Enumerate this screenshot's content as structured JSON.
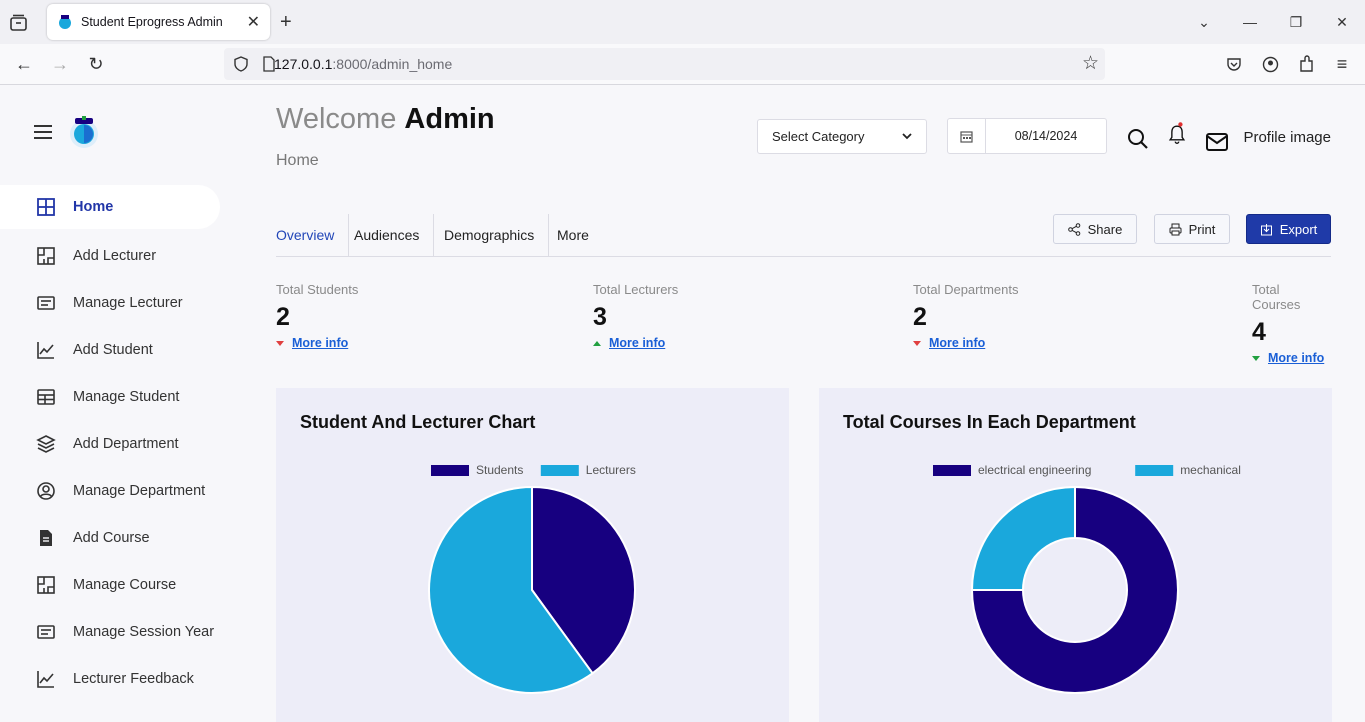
{
  "browser": {
    "tab_title": "Student Eprogress Admin",
    "url_host": "127.0.0.1",
    "url_rest": ":8000/admin_home"
  },
  "sidebar": {
    "items": [
      {
        "label": "Home",
        "icon": "grid-icon"
      },
      {
        "label": "Add Lecturer",
        "icon": "floorplan-icon"
      },
      {
        "label": "Manage Lecturer",
        "icon": "card-text-icon"
      },
      {
        "label": "Add Student",
        "icon": "graph-up-icon"
      },
      {
        "label": "Manage Student",
        "icon": "table-icon"
      },
      {
        "label": "Add Department",
        "icon": "layers-icon"
      },
      {
        "label": "Manage Department",
        "icon": "person-circle-icon"
      },
      {
        "label": "Add Course",
        "icon": "file-text-icon"
      },
      {
        "label": "Manage Course",
        "icon": "floorplan-icon"
      },
      {
        "label": "Manage Session Year",
        "icon": "card-text-icon"
      },
      {
        "label": "Lecturer Feedback",
        "icon": "graph-up-icon"
      }
    ]
  },
  "header": {
    "welcome": "Welcome",
    "user": "Admin",
    "breadcrumb": "Home",
    "select_label": "Select Category",
    "date": "08/14/2024",
    "profile": "Profile image"
  },
  "tabs": [
    "Overview",
    "Audiences",
    "Demographics",
    "More"
  ],
  "actions": {
    "share": "Share",
    "print": "Print",
    "export": "Export"
  },
  "stats": [
    {
      "label": "Total Students",
      "value": "2",
      "link": "More info",
      "trend": "down"
    },
    {
      "label": "Total Lecturers",
      "value": "3",
      "link": "More info",
      "trend": "up"
    },
    {
      "label": "Total Departments",
      "value": "2",
      "link": "More info",
      "trend": "down"
    },
    {
      "label": "Total Courses",
      "value": "4",
      "link": "More info",
      "trend": "down-green"
    }
  ],
  "colors": {
    "primary": "#1f3aa8",
    "series_dark": "#170080",
    "series_light": "#1aa8dc"
  },
  "chart_data": [
    {
      "type": "pie",
      "title": "Student And Lecturer Chart",
      "categories": [
        "Students",
        "Lecturers"
      ],
      "values": [
        2,
        3
      ],
      "colors": [
        "#170080",
        "#1aa8dc"
      ],
      "legend": "top"
    },
    {
      "type": "pie",
      "variant": "doughnut",
      "title": "Total Courses In Each Department",
      "categories": [
        "electrical engineering",
        "mechanical"
      ],
      "values": [
        3,
        1
      ],
      "colors": [
        "#170080",
        "#1aa8dc"
      ],
      "legend": "top"
    }
  ]
}
